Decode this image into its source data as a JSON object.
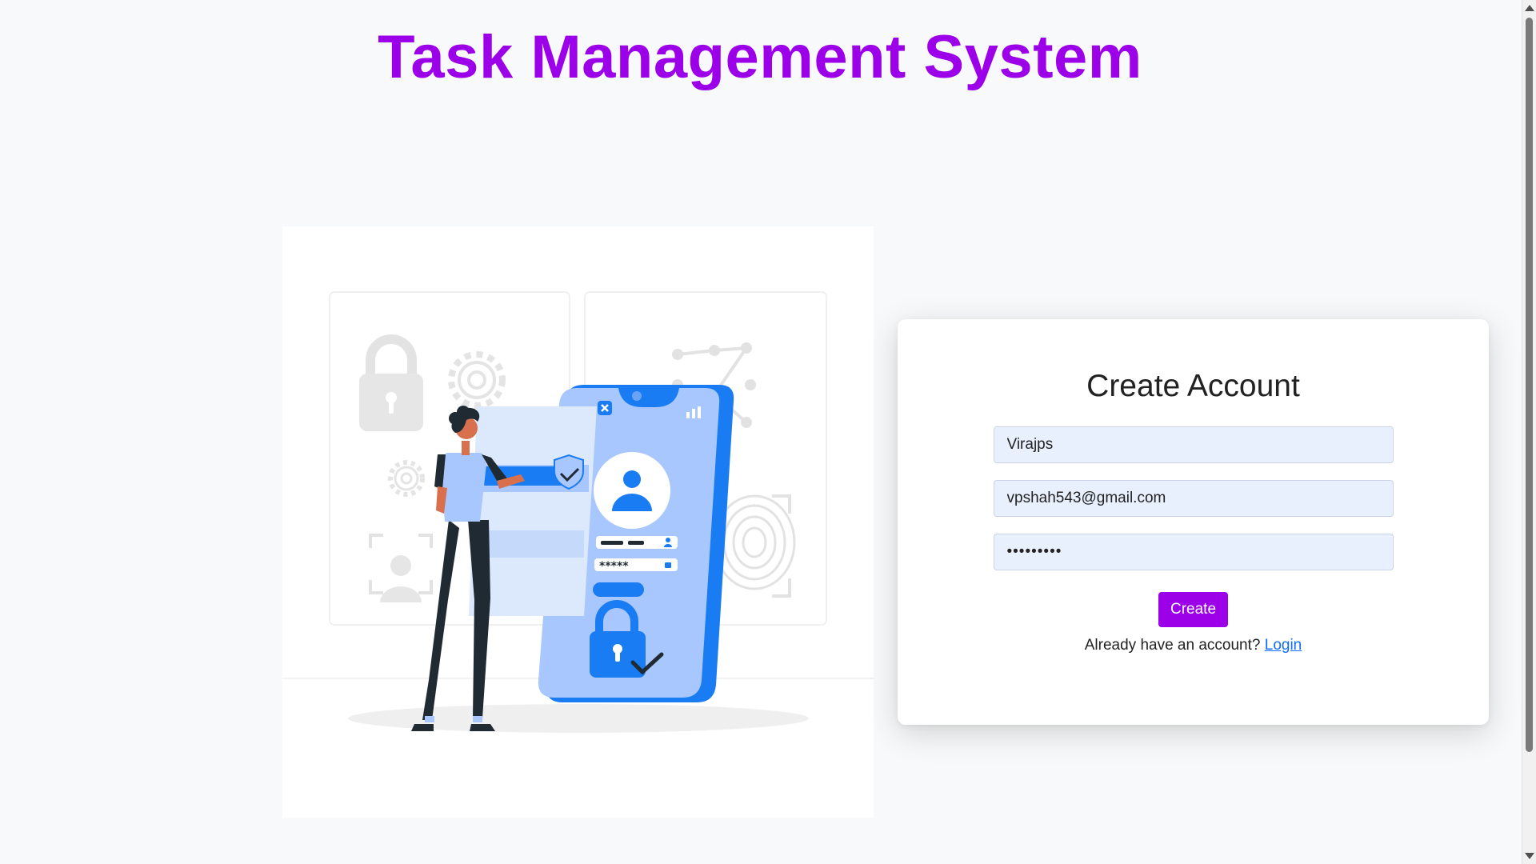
{
  "header": {
    "title": "Task Management System"
  },
  "form": {
    "title": "Create Account",
    "username_value": "Virajps",
    "email_value": "vpshah543@gmail.com",
    "password_value": "virajps12",
    "submit_label": "Create",
    "login_prompt": "Already have an account?",
    "login_link": "Login"
  },
  "illustration": {
    "password_mask": "*****"
  },
  "colors": {
    "brand": "#9b00e8",
    "link": "#0d6efd",
    "input_bg": "#e8f0fe",
    "illustration_blue": "#1a7cf2"
  },
  "icons": [
    "padlock-icon",
    "gear-icon",
    "fingerprint-icon",
    "user-icon",
    "face-scan-icon",
    "shield-check-icon",
    "close-icon"
  ]
}
